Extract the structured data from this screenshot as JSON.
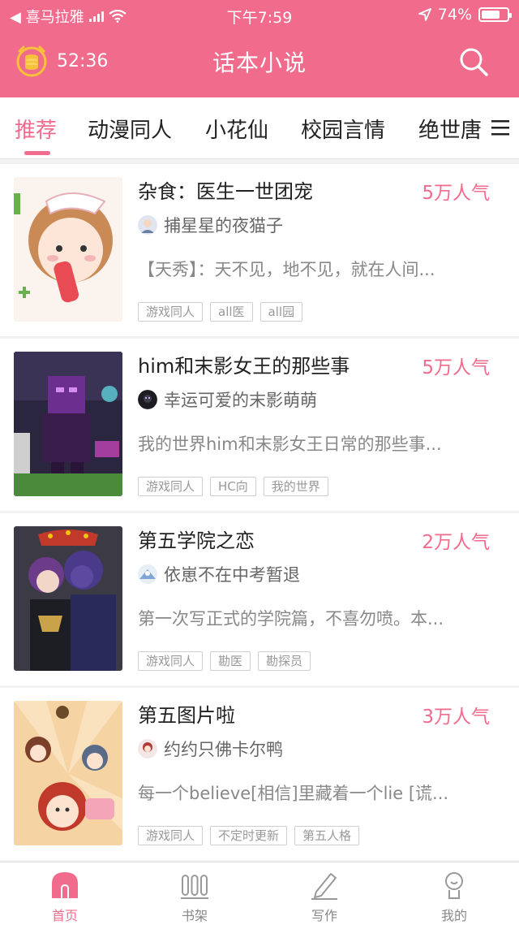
{
  "status_bar": {
    "carrier": "◀ 喜马拉雅",
    "time": "下午7:59",
    "battery": "74%",
    "battery_level": 0.74
  },
  "header": {
    "timer": "52:36",
    "title": "话本小说"
  },
  "tabs": [
    {
      "label": "推荐",
      "active": true
    },
    {
      "label": "动漫同人",
      "active": false
    },
    {
      "label": "小花仙",
      "active": false
    },
    {
      "label": "校园言情",
      "active": false
    },
    {
      "label": "绝世唐",
      "active": false
    }
  ],
  "books": [
    {
      "title": "杂食：医生一世团宠",
      "popularity": "5万人气",
      "author": "捕星星的夜猫子",
      "description": "【天秀】：天不见，地不见，就在人间...",
      "tags": [
        "游戏同人",
        "all医",
        "all园"
      ]
    },
    {
      "title": "him和末影女王的那些事",
      "popularity": "5万人气",
      "author": "幸运可爱的末影萌萌",
      "description": "我的世界him和末影女王日常的那些事...",
      "tags": [
        "游戏同人",
        "HC向",
        "我的世界"
      ]
    },
    {
      "title": "第五学院之恋",
      "popularity": "2万人气",
      "author": "依崽不在中考暂退",
      "description": "第一次写正式的学院篇，不喜勿喷。本...",
      "tags": [
        "游戏同人",
        "勘医",
        "勘探员"
      ]
    },
    {
      "title": "第五图片啦",
      "popularity": "3万人气",
      "author": "约约只佛卡尔鸭",
      "description": "每一个believe[相信]里藏着一个lie [谎...",
      "tags": [
        "游戏同人",
        "不定时更新",
        "第五人格"
      ]
    }
  ],
  "bottom_nav": [
    {
      "label": "首页",
      "icon": "home-icon",
      "active": true
    },
    {
      "label": "书架",
      "icon": "bookshelf-icon",
      "active": false
    },
    {
      "label": "写作",
      "icon": "pen-icon",
      "active": false
    },
    {
      "label": "我的",
      "icon": "profile-icon",
      "active": false
    }
  ],
  "colors": {
    "brand_pink": "#f06b8c",
    "tag_border": "#cfcfcf",
    "text_secondary": "#888888"
  }
}
